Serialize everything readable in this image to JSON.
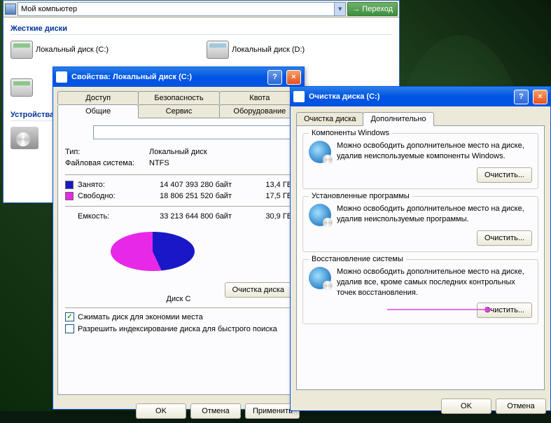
{
  "explorer": {
    "address": "Мой компьютер",
    "go_label": "Переход",
    "section_hard": "Жесткие диски",
    "drive_c": "Локальный диск (C:)",
    "drive_d": "Локальный диск (D:)",
    "section_dev": "Устройства"
  },
  "props": {
    "title": "Свойства: Локальный диск (C:)",
    "tabs": {
      "access": "Доступ",
      "security": "Безопасность",
      "quota": "Квота",
      "general": "Общие",
      "service": "Сервис",
      "hardware": "Оборудование"
    },
    "type_label": "Тип:",
    "type_value": "Локальный диск",
    "fs_label": "Файловая система:",
    "fs_value": "NTFS",
    "used_label": "Занято:",
    "used_bytes": "14 407 393 280 байт",
    "used_gb": "13,4 ГБ",
    "free_label": "Свободно:",
    "free_bytes": "18 806 251 520 байт",
    "free_gb": "17,5 ГБ",
    "cap_label": "Емкость:",
    "cap_bytes": "33 213 644 800 байт",
    "cap_gb": "30,9 ГБ",
    "pie_label": "Диск C",
    "cleanup_btn": "Очистка диска",
    "compress_chk": "Сжимать диск для экономии места",
    "index_chk": "Разрешить индексирование диска для быстрого поиска",
    "ok": "OK",
    "cancel": "Отмена",
    "apply": "Применить"
  },
  "cleanup": {
    "title": "Очистка диска  (C:)",
    "tab_main": "Очистка диска",
    "tab_more": "Дополнительно",
    "grp_components": {
      "title": "Компоненты Windows",
      "text": "Можно освободить дополнительное место на диске, удалив неиспользуемые компоненты Windows.",
      "btn": "Очистить..."
    },
    "grp_programs": {
      "title": "Установленные программы",
      "text": "Можно освободить дополнительное место на диске, удалив неиспользуемые программы.",
      "btn": "Очистить..."
    },
    "grp_restore": {
      "title": "Восстановление системы",
      "text": "Можно освободить дополнительное место на диске, удалив все, кроме самых последних контрольных точек восстановления.",
      "btn": "Очистить..."
    },
    "ok": "OK",
    "cancel": "Отмена"
  },
  "chart_data": {
    "type": "pie",
    "title": "Диск C",
    "series": [
      {
        "name": "Занято",
        "value": 14407393280,
        "display": "13,4 ГБ",
        "color": "#1818c8"
      },
      {
        "name": "Свободно",
        "value": 18806251520,
        "display": "17,5 ГБ",
        "color": "#e828e8"
      }
    ],
    "total": {
      "name": "Емкость",
      "value": 33213644800,
      "display": "30,9 ГБ"
    }
  }
}
